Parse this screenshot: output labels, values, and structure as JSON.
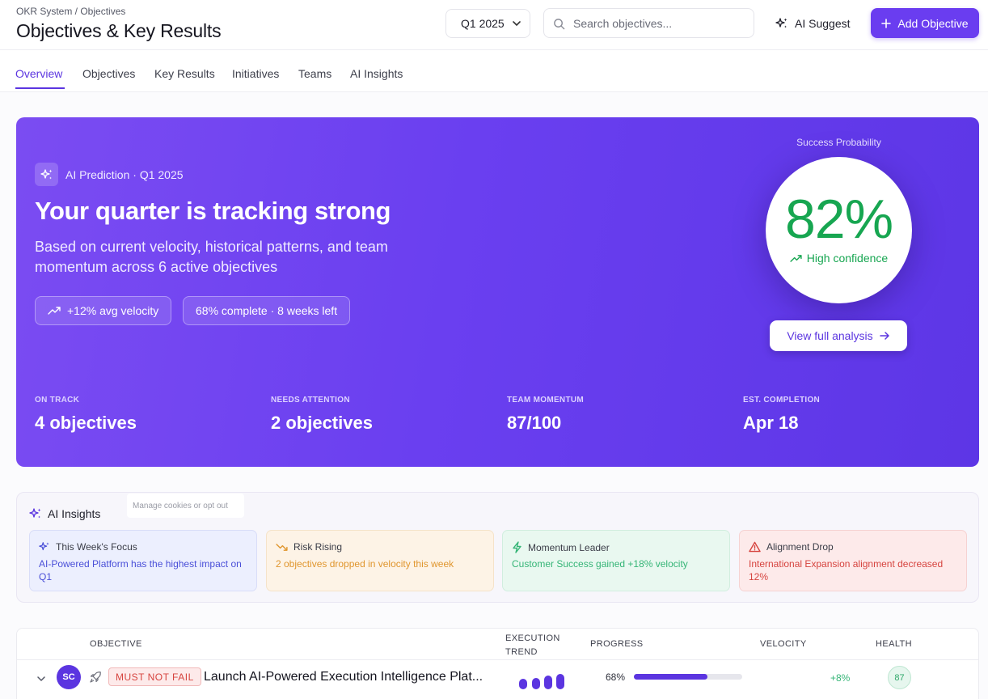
{
  "header": {
    "breadcrumb": "OKR System / Objectives",
    "title": "Objectives & Key Results",
    "quarter": "Q1 2025",
    "search_placeholder": "Search objectives...",
    "ai_suggest_label": "AI Suggest",
    "add_objective_label": "Add Objective"
  },
  "tabs": [
    {
      "label": "Overview",
      "active": true
    },
    {
      "label": "Objectives"
    },
    {
      "label": "Key Results"
    },
    {
      "label": "Initiatives"
    },
    {
      "label": "Teams"
    },
    {
      "label": "AI Insights"
    }
  ],
  "hero": {
    "badge": "AI Prediction · Q1 2025",
    "title": "Your quarter is tracking strong",
    "subtitle": "Based on current velocity, historical patterns, and team momentum across 6 active objectives",
    "chip_velocity": "+12% avg velocity",
    "chip_progress": "68% complete · 8 weeks left",
    "probability_label": "Success Probability",
    "probability_value": "82%",
    "confidence": "High confidence",
    "view_analysis_label": "View full analysis",
    "stats": [
      {
        "label": "ON TRACK",
        "value": "4 objectives"
      },
      {
        "label": "NEEDS ATTENTION",
        "value": "2 objectives"
      },
      {
        "label": "TEAM MOMENTUM",
        "value": "87/100"
      },
      {
        "label": "EST. COMPLETION",
        "value": "Apr 18"
      }
    ]
  },
  "insights": {
    "title": "AI Insights",
    "cookie_tip": "Manage cookies or opt out",
    "cards": [
      {
        "title": "This Week's Focus",
        "body": "AI-Powered Platform has the highest impact on Q1",
        "tone": "blue"
      },
      {
        "title": "Risk Rising",
        "body": "2 objectives dropped in velocity this week",
        "tone": "orange"
      },
      {
        "title": "Momentum Leader",
        "body": "Customer Success gained +18% velocity",
        "tone": "green"
      },
      {
        "title": "Alignment Drop",
        "body": "International Expansion alignment decreased 12%",
        "tone": "red"
      }
    ]
  },
  "table": {
    "columns": [
      "OBJECTIVE",
      "EXECUTION TREND",
      "PROGRESS",
      "VELOCITY",
      "HEALTH"
    ],
    "rows": [
      {
        "owner_initials": "SC",
        "tag": "MUST NOT FAIL",
        "name": "Launch AI-Powered Execution Intelligence Plat...",
        "progress_label": "68%",
        "progress": 0.68,
        "velocity": "+8%",
        "health": "87"
      }
    ]
  },
  "colors": {
    "accent": "#5b35e0",
    "hero_gradient_start": "#7b4cf2",
    "hero_gradient_end": "#5d36e6",
    "success": "#17a651",
    "warning": "#e0962e",
    "danger": "#d6443f"
  },
  "icons": {
    "chevron": "chevron-down-icon",
    "search": "search-icon",
    "sparkles": "sparkles-icon",
    "plus": "plus-icon",
    "trend_up": "trend-up-icon",
    "arrow_right": "arrow-right-icon",
    "trend_down": "trend-down-icon",
    "bolt": "bolt-icon",
    "warning": "warning-triangle-icon",
    "rocket": "rocket-icon"
  }
}
